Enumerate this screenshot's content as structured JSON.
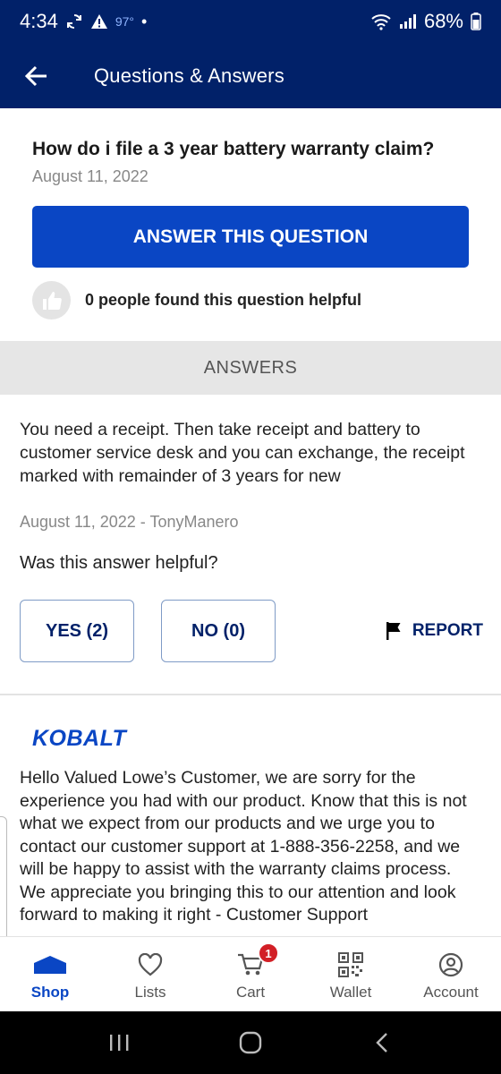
{
  "status_bar": {
    "time": "4:34",
    "temperature": "97°",
    "battery": "68%",
    "icons": [
      "sync-icon",
      "warning-icon",
      "wifi-icon",
      "signal-icon",
      "battery-icon"
    ]
  },
  "header": {
    "title": "Questions & Answers",
    "background_color": "#012169"
  },
  "question": {
    "title": "How do i file a 3 year battery warranty claim?",
    "date": "August 11, 2022",
    "answer_button_label": "ANSWER THIS QUESTION",
    "helpful_text": "0 people found this question helpful"
  },
  "answers_heading": "ANSWERS",
  "answers": [
    {
      "text": "You need a receipt.  Then take receipt and battery to customer service desk and you can exchange, the receipt marked with remainder of 3 years for new",
      "meta": "August 11, 2022 - TonyManero",
      "helpful_prompt": "Was this answer helpful?",
      "yes_label": "YES (2)",
      "no_label": "NO (0)",
      "report_label": "REPORT"
    },
    {
      "brand": "KOBALT",
      "text": "Hello Valued Lowe’s Customer, we are sorry for the experience you had with our product. Know that this is not what we expect from our products and we urge you to contact our customer support at 1-888-356-2258, and we will be happy to assist with the warranty claims process. We appreciate you bringing this to our attention and look forward to making it right - Customer Support"
    }
  ],
  "bottom_nav": {
    "items": [
      {
        "label": "Shop",
        "icon": "home-icon",
        "active": true
      },
      {
        "label": "Lists",
        "icon": "heart-icon",
        "active": false
      },
      {
        "label": "Cart",
        "icon": "cart-icon",
        "active": false,
        "badge": "1"
      },
      {
        "label": "Wallet",
        "icon": "qr-code-icon",
        "active": false
      },
      {
        "label": "Account",
        "icon": "account-icon",
        "active": false
      }
    ]
  },
  "colors": {
    "brand_navy": "#012169",
    "button_blue": "#0a46c4",
    "badge_red": "#d21f26"
  }
}
